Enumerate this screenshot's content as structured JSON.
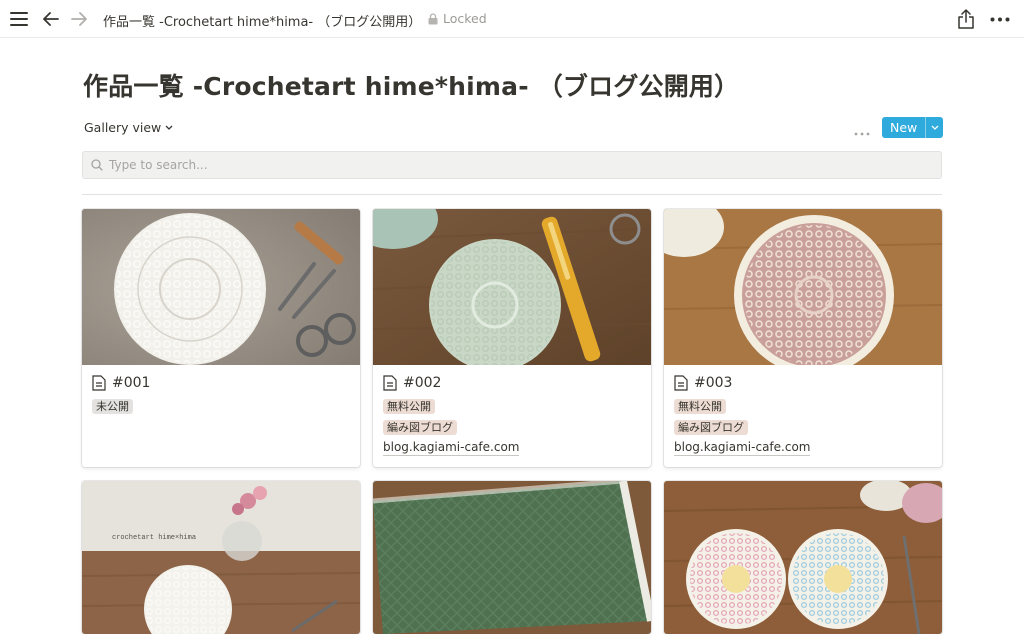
{
  "topbar": {
    "breadcrumb": "作品一覧 -Crochetart hime*hima- （ブログ公開用）",
    "lock_label": "Locked"
  },
  "page": {
    "title": "作品一覧 -Crochetart hime*hima- （ブログ公開用）"
  },
  "toolbar": {
    "view_label": "Gallery view",
    "new_label": "New"
  },
  "search": {
    "placeholder": "Type to search..."
  },
  "colors": {
    "accent": "#2eaadc",
    "tag_brown": "#e8dcd5",
    "tag_gray": "#e3e2e0"
  },
  "cards": [
    {
      "title": "#001",
      "tags": [
        "未公開"
      ],
      "tag_colors": [
        "#e3e2e0"
      ],
      "link": ""
    },
    {
      "title": "#002",
      "tags": [
        "無料公開",
        "編み図ブログ"
      ],
      "tag_colors": [
        "#ecdcd3",
        "#ecdcd3"
      ],
      "link": "blog.kagiami-cafe.com"
    },
    {
      "title": "#003",
      "tags": [
        "無料公開",
        "編み図ブログ"
      ],
      "tag_colors": [
        "#ecdcd3",
        "#ecdcd3"
      ],
      "link": "blog.kagiami-cafe.com"
    },
    {
      "title": "",
      "tags": [],
      "tag_colors": [],
      "link": "",
      "watermark": "crochetart hime×hima"
    },
    {
      "title": "",
      "tags": [],
      "tag_colors": [],
      "link": ""
    },
    {
      "title": "",
      "tags": [],
      "tag_colors": [],
      "link": ""
    }
  ]
}
